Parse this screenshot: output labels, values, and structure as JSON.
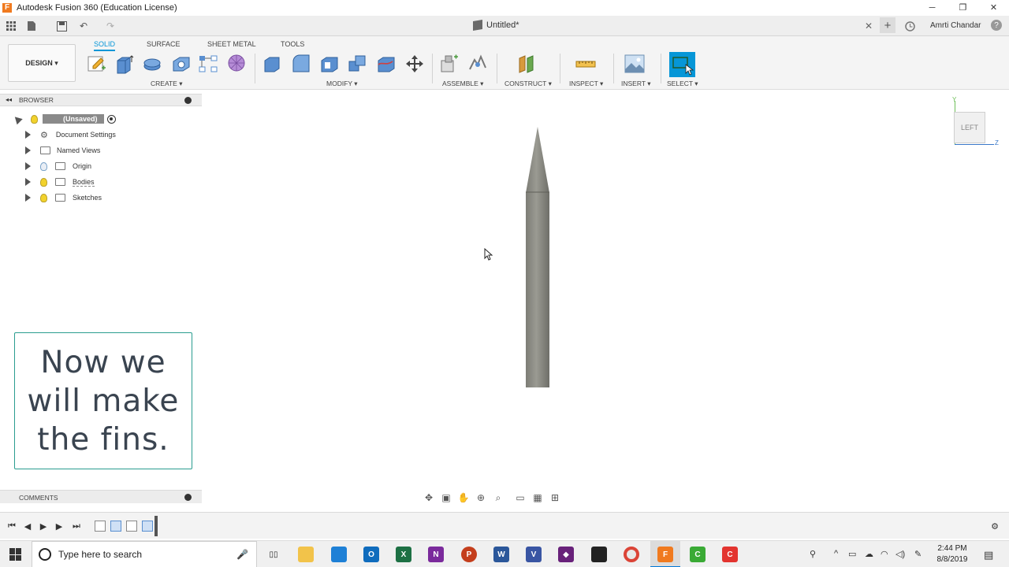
{
  "window": {
    "title": "Autodesk Fusion 360 (Education License)",
    "logo_letter": "F",
    "minimize": "─",
    "restore": "❐",
    "close": "✕"
  },
  "qab": {
    "doc_title": "Untitled*",
    "user": "Amrti Chandar",
    "close_tab": "✕",
    "new_tab": "+",
    "help": "?"
  },
  "toolbar": {
    "design_label": "DESIGN ▾",
    "tabs": [
      "SOLID",
      "SURFACE",
      "SHEET METAL",
      "TOOLS"
    ],
    "groups": {
      "create": "CREATE ▾",
      "modify": "MODIFY ▾",
      "assemble": "ASSEMBLE ▾",
      "construct": "CONSTRUCT ▾",
      "inspect": "INSPECT ▾",
      "insert": "INSERT ▾",
      "select": "SELECT ▾"
    }
  },
  "browser": {
    "header": "BROWSER",
    "collapse": "◂◂",
    "root": "(Unsaved)",
    "items": [
      {
        "label": "Document Settings",
        "icon": "gear-icon"
      },
      {
        "label": "Named Views",
        "icon": "folder-icon"
      },
      {
        "label": "Origin",
        "icon": "folder-icon"
      },
      {
        "label": "Bodies",
        "icon": "folder-icon"
      },
      {
        "label": "Sketches",
        "icon": "folder-icon"
      }
    ]
  },
  "comments": {
    "header": "COMMENTS"
  },
  "caption": {
    "lines": [
      "Now we",
      "will make",
      "the fins."
    ]
  },
  "viewcube": {
    "face": "LEFT",
    "axis_y": "Y",
    "axis_z": "Z"
  },
  "taskbar": {
    "search_placeholder": "Type here to search",
    "time": "2:44 PM",
    "date": "8/8/2019"
  },
  "colors": {
    "accent": "#0696d7",
    "caption_border": "#2a9d8f",
    "model_body": "#8a8a82"
  }
}
